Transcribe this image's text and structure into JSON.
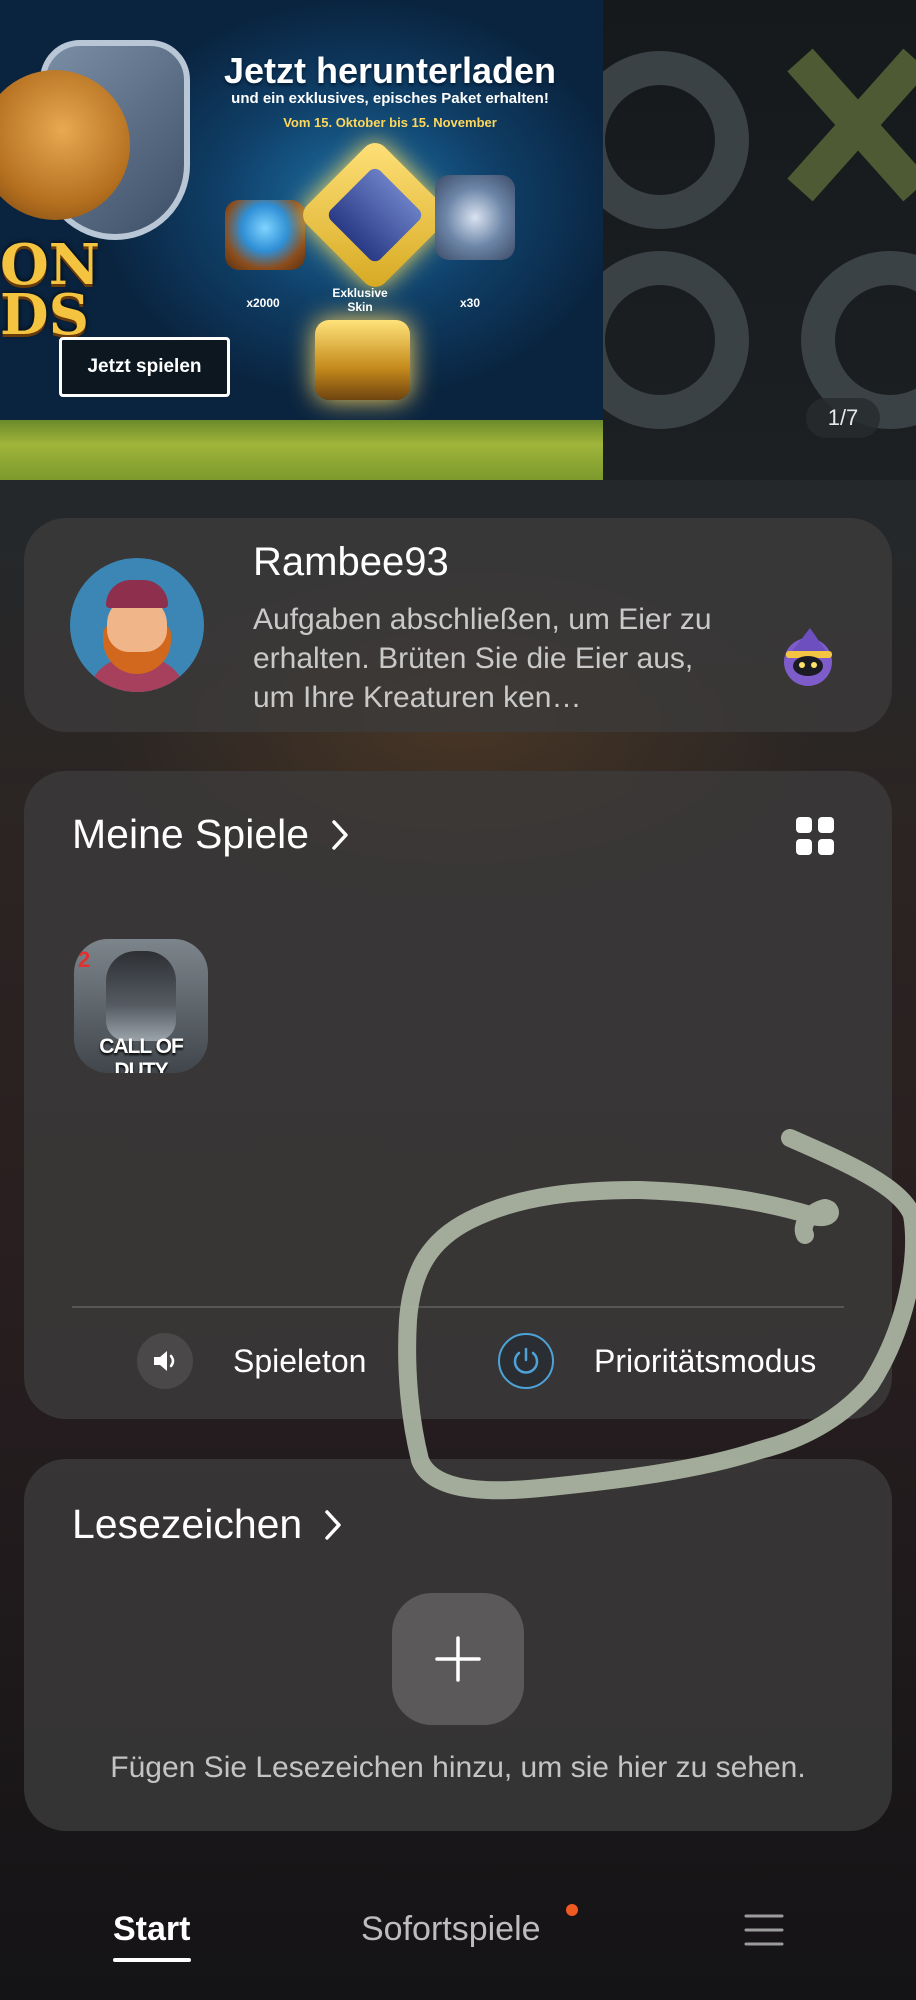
{
  "banner": {
    "title": "Jetzt herunterladen",
    "subtitle": "und ein exklusives, episches Paket erhalten!",
    "date_range": "Vom 15. Oktober bis 15. November",
    "logo_text": "ON\nDS",
    "item_gems_label": "x2000",
    "item_skin_label": "Exklusive Skin",
    "item_weapons_label": "x30",
    "cta_label": "Jetzt spielen",
    "page_indicator": "1/7"
  },
  "profile": {
    "username": "Rambee93",
    "description": "Aufgaben abschließen, um Eier zu erhalten. Brüten Sie die Eier aus, um Ihre Kreaturen ken…"
  },
  "my_games": {
    "title": "Meine Spiele",
    "games": [
      {
        "badge": "2",
        "title_text": "CALL OF DUTY"
      }
    ],
    "controls": {
      "sound_label": "Spieleton",
      "priority_label": "Prioritätsmodus"
    }
  },
  "bookmarks": {
    "title": "Lesezeichen",
    "hint": "Fügen Sie Lesezeichen hinzu, um sie hier zu sehen."
  },
  "nav": {
    "start_label": "Start",
    "instant_label": "Sofortspiele"
  },
  "colors": {
    "accent_blue": "#4da3d8",
    "notification_dot": "#f05a22",
    "annotation_stroke": "#a9b3a0"
  }
}
